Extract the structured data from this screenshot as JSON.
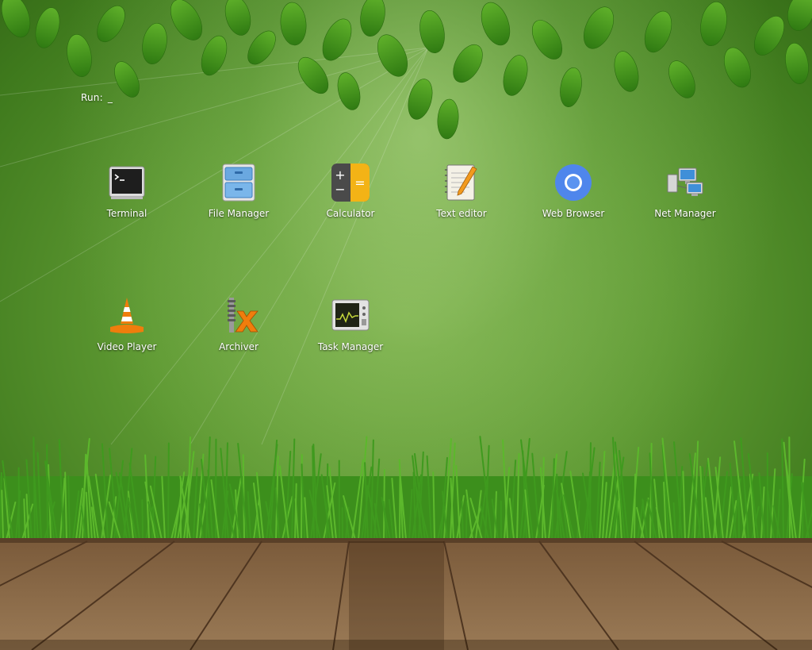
{
  "run_prompt": {
    "label": "Run:",
    "cursor": "_"
  },
  "apps": [
    {
      "label": "Terminal",
      "icon": "terminal-icon"
    },
    {
      "label": "File Manager",
      "icon": "file-cabinet-icon"
    },
    {
      "label": "Calculator",
      "icon": "calculator-icon"
    },
    {
      "label": "Text editor",
      "icon": "notepad-pencil-icon"
    },
    {
      "label": "Web Browser",
      "icon": "chromium-icon"
    },
    {
      "label": "Net Manager",
      "icon": "network-computers-icon"
    },
    {
      "label": "Video Player",
      "icon": "traffic-cone-icon"
    },
    {
      "label": "Archiver",
      "icon": "archive-zipper-icon"
    },
    {
      "label": "Task Manager",
      "icon": "system-monitor-icon"
    }
  ],
  "theme": {
    "background_green": "#5f9a33",
    "leaf_green": "#4e9a1f",
    "grass_green": "#3f9a22",
    "wood_brown": "#8a6a48",
    "label_color": "#ffffff"
  }
}
